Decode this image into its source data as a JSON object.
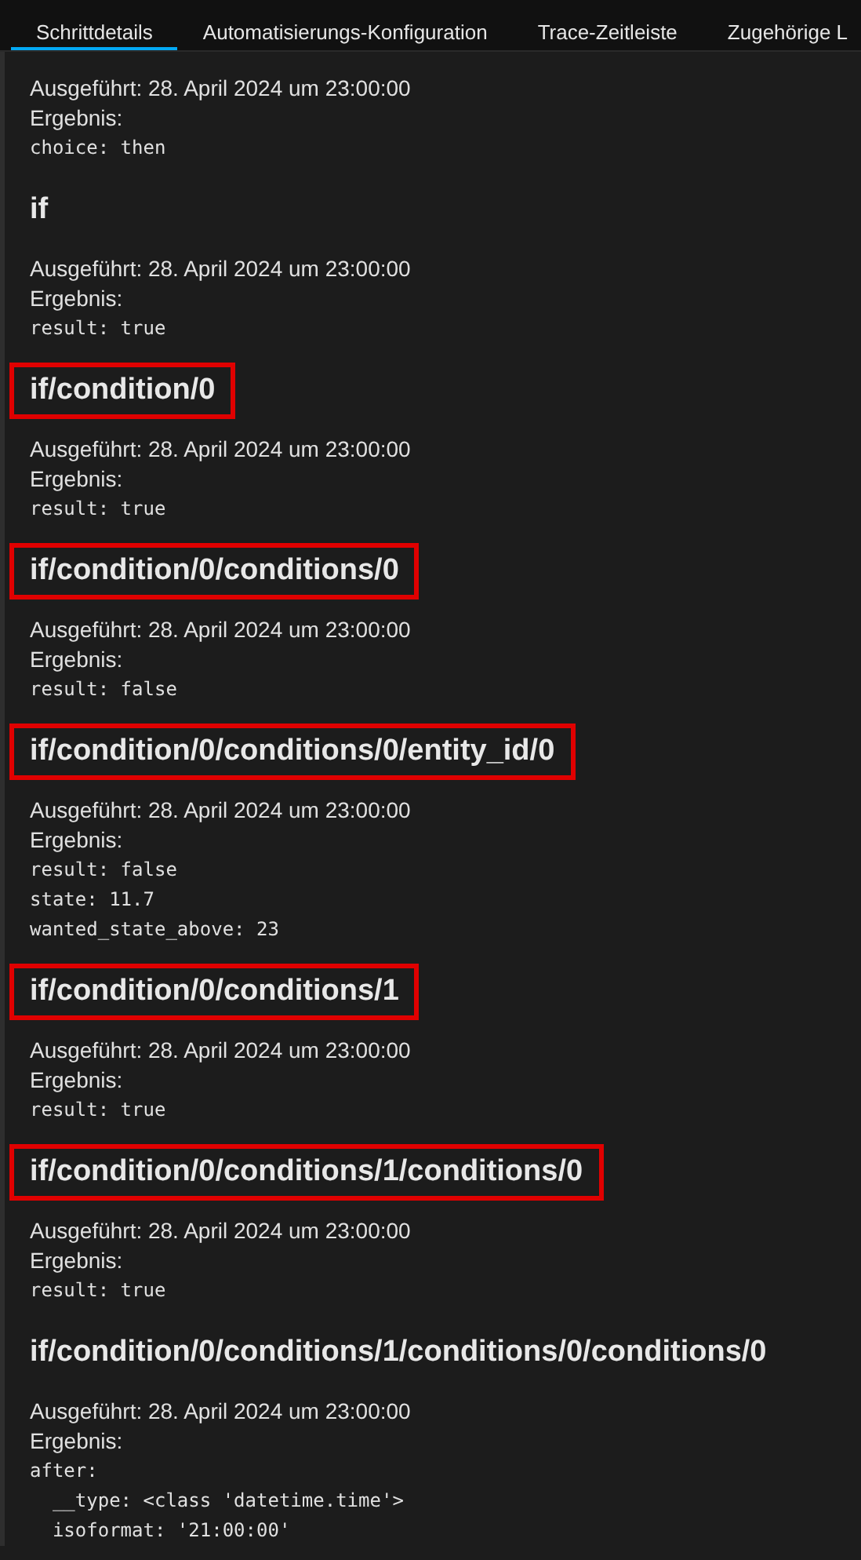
{
  "tabs": [
    {
      "label": "Schrittdetails",
      "selected": true
    },
    {
      "label": "Automatisierungs-Konfiguration",
      "selected": false
    },
    {
      "label": "Trace-Zeitleiste",
      "selected": false
    },
    {
      "label": "Zugehörige L",
      "selected": false
    }
  ],
  "steps": [
    {
      "executed": "Ausgeführt: 28. April 2024 um 23:00:00",
      "result_label": "Ergebnis:",
      "lines": [
        "choice: then"
      ]
    },
    {
      "heading": "if",
      "highlighted": false,
      "executed": "Ausgeführt: 28. April 2024 um 23:00:00",
      "result_label": "Ergebnis:",
      "lines": [
        "result: true"
      ]
    },
    {
      "heading": "if/condition/0",
      "highlighted": true,
      "executed": "Ausgeführt: 28. April 2024 um 23:00:00",
      "result_label": "Ergebnis:",
      "lines": [
        "result: true"
      ]
    },
    {
      "heading": "if/condition/0/conditions/0",
      "highlighted": true,
      "executed": "Ausgeführt: 28. April 2024 um 23:00:00",
      "result_label": "Ergebnis:",
      "lines": [
        "result: false"
      ]
    },
    {
      "heading": "if/condition/0/conditions/0/entity_id/0",
      "highlighted": true,
      "executed": "Ausgeführt: 28. April 2024 um 23:00:00",
      "result_label": "Ergebnis:",
      "lines": [
        "result: false",
        "state: 11.7",
        "wanted_state_above: 23"
      ]
    },
    {
      "heading": "if/condition/0/conditions/1",
      "highlighted": true,
      "executed": "Ausgeführt: 28. April 2024 um 23:00:00",
      "result_label": "Ergebnis:",
      "lines": [
        "result: true"
      ]
    },
    {
      "heading": "if/condition/0/conditions/1/conditions/0",
      "highlighted": true,
      "executed": "Ausgeführt: 28. April 2024 um 23:00:00",
      "result_label": "Ergebnis:",
      "lines": [
        "result: true"
      ]
    },
    {
      "heading": "if/condition/0/conditions/1/conditions/0/conditions/0",
      "highlighted": false,
      "executed": "Ausgeführt: 28. April 2024 um 23:00:00",
      "result_label": "Ergebnis:",
      "lines": [
        "after:",
        "  __type: <class 'datetime.time'>",
        "  isoformat: '21:00:00'"
      ]
    }
  ]
}
